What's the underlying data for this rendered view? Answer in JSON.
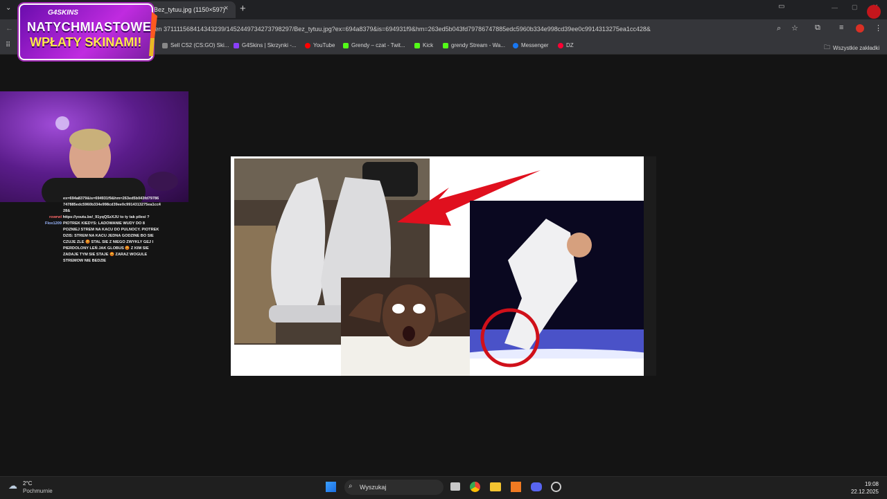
{
  "browser": {
    "tab_title": "Bez_tytuu.jpg (1150×597)",
    "tab_close": "×",
    "new_tab": "+",
    "address": "men 371111568414343239/1452449734273798297/Bez_tytuu.jpg?ex=694a8379&is=694931f9&hm=263ed5b043fd79786747885edc5960b334e998cd39ee0c9914313275ea1cc428&",
    "bookmarks": [
      {
        "label": "Sell CS2 (CS:GO) Ski...",
        "color": "#888888"
      },
      {
        "label": "G4Skins | Skrzynki -...",
        "color": "#8a3ffc"
      },
      {
        "label": "YouTube",
        "color": "#ff0000"
      },
      {
        "label": "Grendy – czat - Twit...",
        "color": "#53fc18"
      },
      {
        "label": "Kick",
        "color": "#53fc18"
      },
      {
        "label": "grendy Stream - Wa...",
        "color": "#53fc18"
      },
      {
        "label": "Messenger",
        "color": "#1877f2"
      },
      {
        "label": "DZ",
        "color": "#ff0033"
      }
    ],
    "all_bookmarks": "Wszystkie zakładki"
  },
  "promo": {
    "brand": "G4SKINS",
    "line1": "NATYCHMIASTOWE",
    "line2": "WPŁATY SKINAMI!"
  },
  "chat": {
    "line0": "ex=694a8379&is=694931f9&hm=263ed5b043fd79786747885edc5960b334e998cd39ee0c9914313275ea1cc428&",
    "user1": "rowrwl",
    "msg1": "https://youtu.be/_91yqQSzXJU to ty tak pilesi ?",
    "user2": "Flox1209",
    "msg2": "PIOTREK KIEDYS: LADOWANIE WUDY DO 8 POZNIEJ STREM NA KACU DO PULNOCY. PIOTREK DZIS: STREM NA KACU JEDNA GODZINE BO SIE CZUJE ZLE 😡 STAL SIE Z NIEGO ZWYKLY GEJ I PIERDOLONY LEŃ JAK GLOBUS 😡 Z KIM SIE ZADAJE TYM SIE STAJE 😡 ZARAZ WOGULE STREMOW NIE BEDZIE"
  },
  "taskbar": {
    "temp": "2°C",
    "condition": "Pochmurnie",
    "search_placeholder": "Wyszukaj",
    "time": "19:08",
    "date": "22.12.2025"
  },
  "colors": {
    "arrow": "#e0101e",
    "circle": "#d0101a",
    "promo_bg": "#a020d0",
    "promo_yellow": "#ffe94a"
  }
}
